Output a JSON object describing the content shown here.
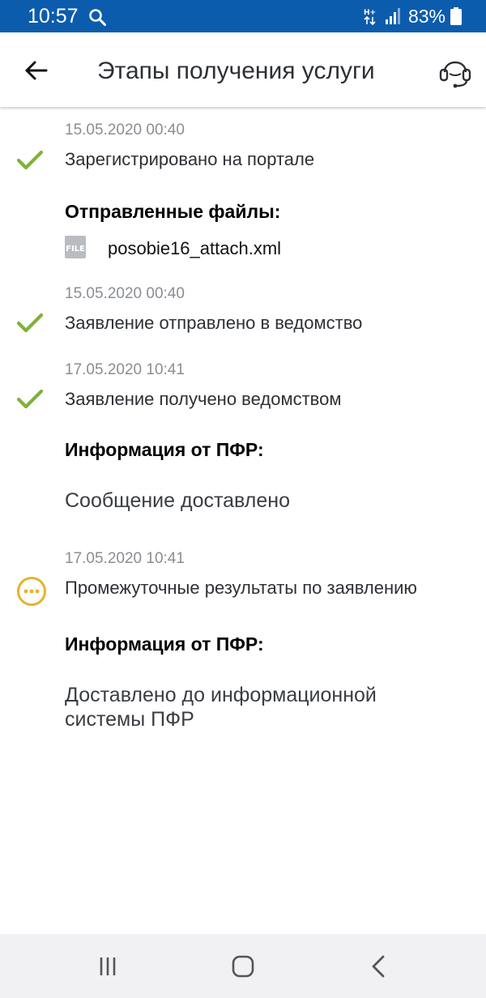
{
  "status_bar": {
    "time": "10:57",
    "battery": "83%",
    "icons": [
      "search-icon",
      "network-icon",
      "signal-icon",
      "battery-icon"
    ]
  },
  "header": {
    "title": "Этапы получения услуги",
    "back_icon": "arrow-left-icon",
    "support_icon": "headset-icon"
  },
  "colors": {
    "status_bar": "#0c5cad",
    "check": "#7fb23a",
    "pending": "#e7b22d",
    "date_text": "#8a8e94"
  },
  "timeline": {
    "step1": {
      "date": "15.05.2020 00:40",
      "text": "Зарегистрировано на портале",
      "status": "done",
      "files_heading": "Отправленные файлы:",
      "file_badge": "FILE",
      "file_name": "posobie16_attach.xml"
    },
    "step2": {
      "date": "15.05.2020 00:40",
      "text": "Заявление отправлено в ведомство",
      "status": "done"
    },
    "step3": {
      "date": "17.05.2020 10:41",
      "text": "Заявление получено ведомством",
      "status": "done",
      "info_heading": "Информация от ПФР:",
      "info_text": "Сообщение доставлено"
    },
    "step4": {
      "date": "17.05.2020 10:41",
      "text": "Промежуточные результаты по заявлению",
      "status": "in-progress",
      "info_heading": "Информация от ПФР:",
      "info_text": "Доставлено до информационной системы ПФР"
    }
  },
  "nav_bar": {
    "icons": [
      "recent-apps-icon",
      "home-icon",
      "back-icon"
    ]
  }
}
